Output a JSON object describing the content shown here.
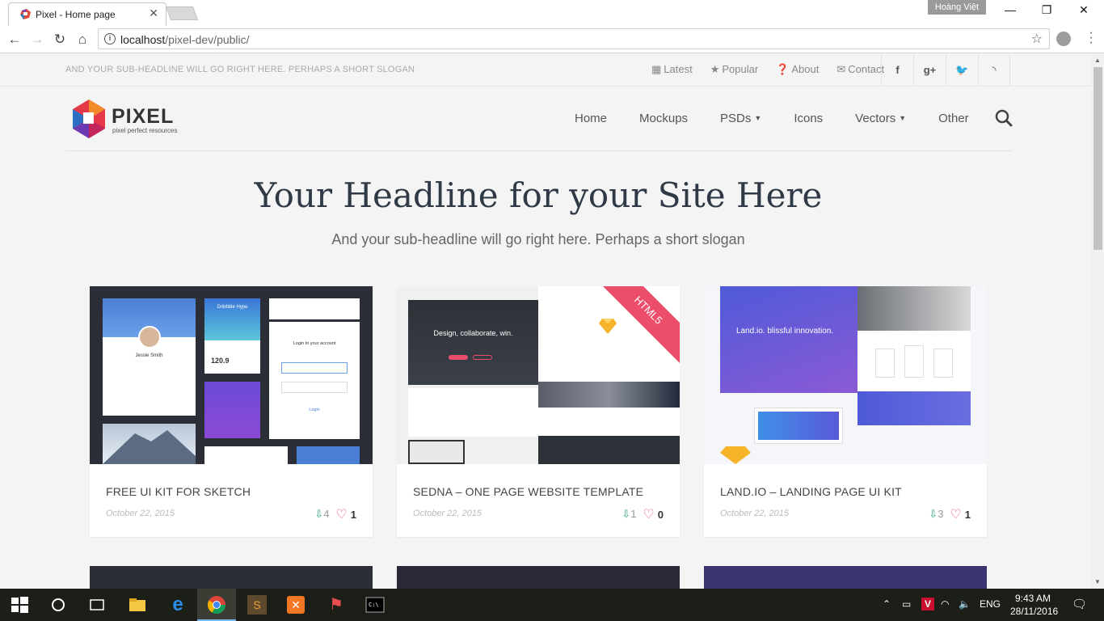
{
  "browser": {
    "tab_title": "Pixel - Home page",
    "profile_name": "Hoàng Việt",
    "url_host": "localhost",
    "url_path": "/pixel-dev/public/"
  },
  "site": {
    "tagline": "AND YOUR SUB-HEADLINE WILL GO RIGHT HERE. PERHAPS A SHORT SLOGAN",
    "toplinks": [
      "Latest",
      "Popular",
      "About",
      "Contact"
    ],
    "social": [
      "f",
      "g+",
      "t",
      "rss"
    ],
    "logo_text": "PIXEL",
    "logo_sub": "pixel perfect resources",
    "nav": [
      "Home",
      "Mockups",
      "PSDs",
      "Icons",
      "Vectors",
      "Other"
    ],
    "headline": "Your Headline for your Site Here",
    "subheadline": "And your sub-headline will go right here. Perhaps a short slogan"
  },
  "cards": [
    {
      "title": "FREE UI KIT FOR SKETCH",
      "date": "October 22, 2015",
      "downloads": "4",
      "likes": "1"
    },
    {
      "title": "SEDNA – ONE PAGE WEBSITE TEMPLATE",
      "date": "October 22, 2015",
      "downloads": "1",
      "likes": "0"
    },
    {
      "title": "LAND.IO – LANDING PAGE UI KIT",
      "date": "October 22, 2015",
      "downloads": "3",
      "likes": "1"
    }
  ],
  "thumb_text": {
    "card1_name": "Jessie Smith",
    "card1_dribbble": "Dribbble Hype",
    "card1_value": "120.9",
    "card1_login": "Login to your account",
    "card1_login_btn": "Login",
    "card2_heading": "Design, collaborate, win.",
    "card2_badge": "HTML5",
    "card3_heading": "Land.io. blissful innovation."
  },
  "taskbar": {
    "lang": "ENG",
    "time": "9:43 AM",
    "date": "28/11/2016"
  },
  "colors": {
    "accent_green": "#2ea77a",
    "heart_red": "#e8506b",
    "badge_pink": "#ec4d6b"
  }
}
